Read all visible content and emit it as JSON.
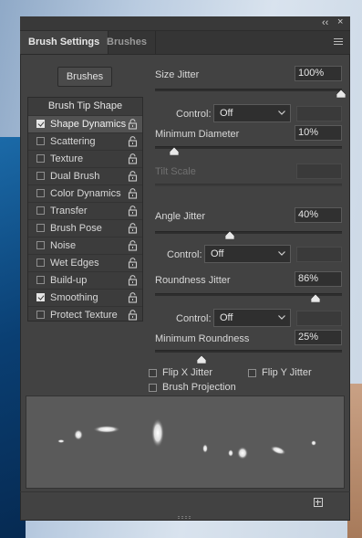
{
  "window": {
    "collapse_label": "‹‹",
    "close_label": "×"
  },
  "tabs": [
    {
      "label": "Brush Settings",
      "active": true
    },
    {
      "label": "Brushes",
      "active": false
    }
  ],
  "brushes_button": "Brushes",
  "list": {
    "header": "Brush Tip Shape",
    "items": [
      {
        "label": "Shape Dynamics",
        "checked": true,
        "active": true
      },
      {
        "label": "Scattering",
        "checked": false
      },
      {
        "label": "Texture",
        "checked": false
      },
      {
        "label": "Dual Brush",
        "checked": false
      },
      {
        "label": "Color Dynamics",
        "checked": false
      },
      {
        "label": "Transfer",
        "checked": false
      },
      {
        "label": "Brush Pose",
        "checked": false
      },
      {
        "label": "Noise",
        "checked": false
      },
      {
        "label": "Wet Edges",
        "checked": false
      },
      {
        "label": "Build-up",
        "checked": false
      },
      {
        "label": "Smoothing",
        "checked": true
      },
      {
        "label": "Protect Texture",
        "checked": false
      }
    ]
  },
  "settings": {
    "size_jitter": {
      "label": "Size Jitter",
      "value": "100%",
      "level": 1.0
    },
    "size_control": {
      "label": "Control:",
      "value": "Off"
    },
    "min_diameter": {
      "label": "Minimum Diameter",
      "value": "10%",
      "level": 0.1
    },
    "tilt_scale": {
      "label": "Tilt Scale",
      "value": ""
    },
    "angle_jitter": {
      "label": "Angle Jitter",
      "value": "40%",
      "level": 0.4
    },
    "angle_control": {
      "label": "Control:",
      "value": "Off"
    },
    "roundness_jitter": {
      "label": "Roundness Jitter",
      "value": "86%",
      "level": 0.86
    },
    "roundness_control": {
      "label": "Control:",
      "value": "Off"
    },
    "min_roundness": {
      "label": "Minimum Roundness",
      "value": "25%",
      "level": 0.25
    },
    "flip_x": {
      "label": "Flip X Jitter",
      "checked": false
    },
    "flip_y": {
      "label": "Flip Y Jitter",
      "checked": false
    },
    "brush_projection": {
      "label": "Brush Projection",
      "checked": false
    }
  },
  "colors": {
    "panel": "#424242",
    "accent": "#e5e5e5"
  }
}
